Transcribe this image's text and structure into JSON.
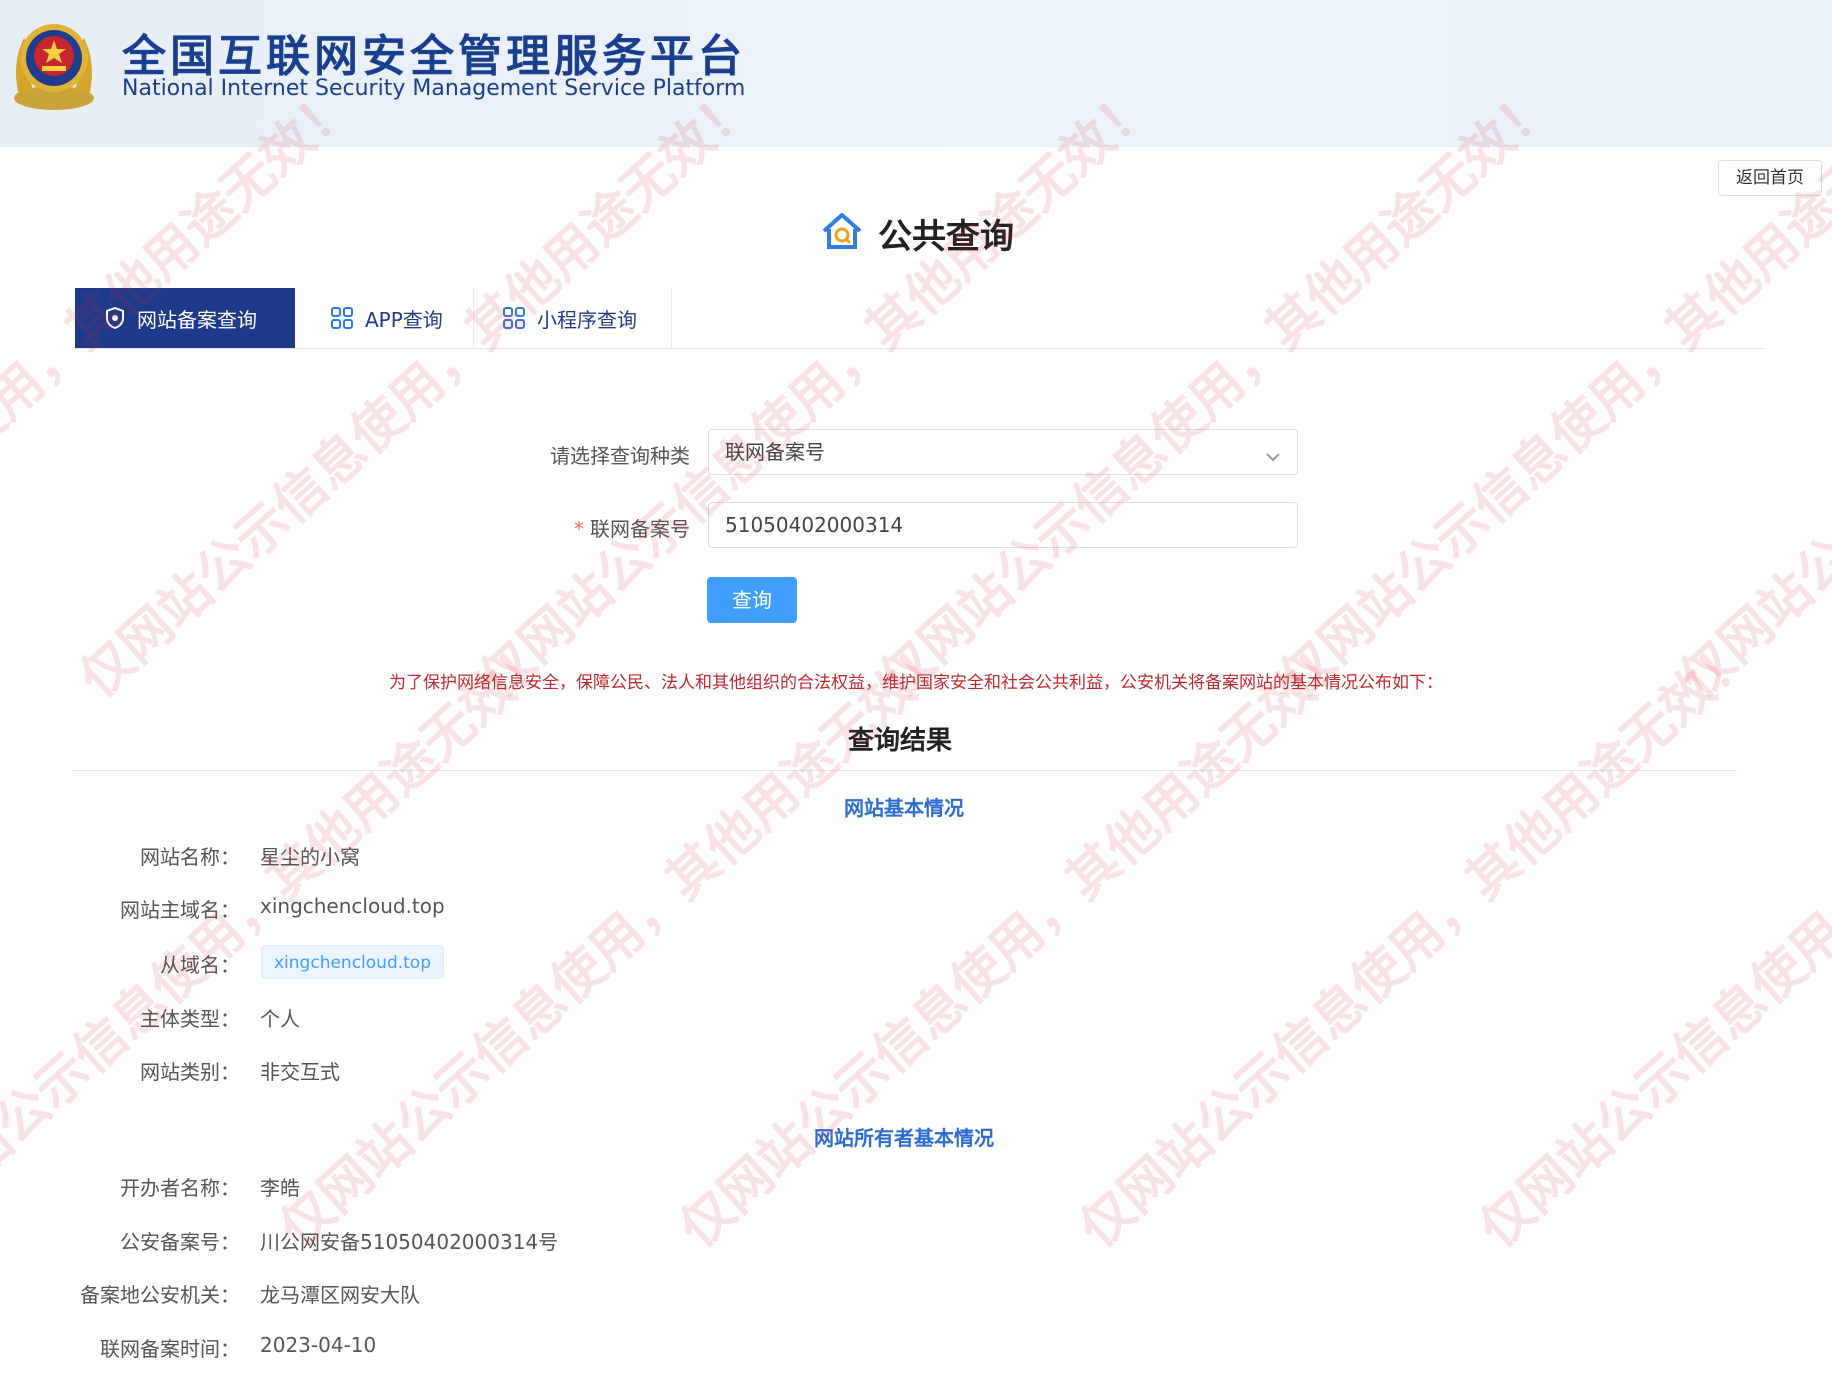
{
  "header": {
    "title_cn": "全国互联网安全管理服务平台",
    "title_en": "National Internet Security Management Service Platform",
    "home_button": "返回首页"
  },
  "page": {
    "heading": "公共查询"
  },
  "tabs": [
    {
      "label": "网站备案查询",
      "icon": "shield-icon",
      "active": true
    },
    {
      "label": "APP查询",
      "icon": "grid-icon",
      "active": false
    },
    {
      "label": "小程序查询",
      "icon": "grid-icon",
      "active": false
    }
  ],
  "form": {
    "type_label": "请选择查询种类",
    "type_value": "联网备案号",
    "number_required_mark": "*",
    "number_label": "联网备案号",
    "number_value": "51050402000314",
    "search_button": "查询"
  },
  "notice": "为了保护网络信息安全，保障公民、法人和其他组织的合法权益，维护国家安全和社会公共利益，公安机关将备案网站的基本情况公布如下：",
  "results": {
    "title": "查询结果",
    "basic": {
      "title": "网站基本情况",
      "site_name_label": "网站名称：",
      "site_name": "星尘的小窝",
      "domain_label": "网站主域名：",
      "domain": "xingchencloud.top",
      "sub_domain_label": "从域名：",
      "sub_domain": "xingchencloud.top",
      "entity_type_label": "主体类型：",
      "entity_type": "个人",
      "site_category_label": "网站类别：",
      "site_category": "非交互式"
    },
    "owner": {
      "title": "网站所有者基本情况",
      "operator_label": "开办者名称：",
      "operator": "李皓",
      "record_no_label": "公安备案号：",
      "record_no": "川公网安备51050402000314号",
      "authority_label": "备案地公安机关：",
      "authority": "龙马潭区网安大队",
      "record_date_label": "联网备案时间：",
      "record_date": "2023-04-10"
    }
  },
  "watermark": {
    "text": "仅网站公示信息使用，其他用途无效！",
    "color": "#d9262e"
  },
  "colors": {
    "brand": "#1b3f8f",
    "active_tab": "#1d3a8a",
    "primary": "#409eff",
    "notice": "#c0292f",
    "section_title": "#2d6dd3"
  }
}
